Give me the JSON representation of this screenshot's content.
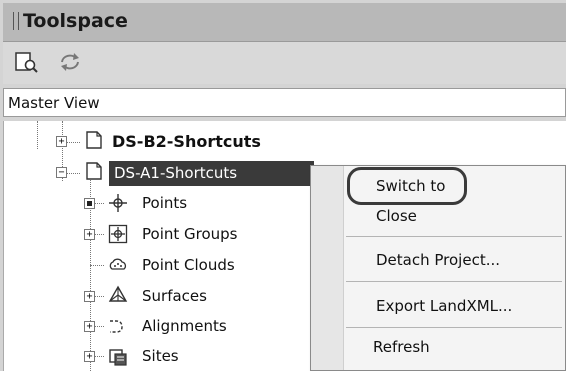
{
  "palette": {
    "title_bar": "#b8b8b8",
    "selection": "#3a3a3a",
    "menu_bg": "#f4f4f4"
  },
  "panel": {
    "title": "Toolspace"
  },
  "toolbar": {
    "items": [
      {
        "name": "project-explorer-icon"
      },
      {
        "name": "refresh-icon"
      }
    ]
  },
  "view": {
    "selected": "Master View"
  },
  "tree": {
    "nodes": [
      {
        "label": "DS-B2-Shortcuts",
        "icon": "folder-icon",
        "bold": true
      },
      {
        "label": "DS-A1-Shortcuts",
        "icon": "folder-icon",
        "selected": true
      },
      {
        "label": "Points",
        "icon": "points-icon"
      },
      {
        "label": "Point Groups",
        "icon": "point-groups-icon"
      },
      {
        "label": "Point Clouds",
        "icon": "point-clouds-icon"
      },
      {
        "label": "Surfaces",
        "icon": "surfaces-icon"
      },
      {
        "label": "Alignments",
        "icon": "alignments-icon"
      },
      {
        "label": "Sites",
        "icon": "sites-icon"
      }
    ]
  },
  "context_menu": {
    "items": [
      {
        "label": "Switch to",
        "highlighted": true
      },
      {
        "label": "Close"
      },
      {
        "label": "Detach Project..."
      },
      {
        "label": "Export LandXML..."
      },
      {
        "label": "Refresh"
      }
    ]
  }
}
